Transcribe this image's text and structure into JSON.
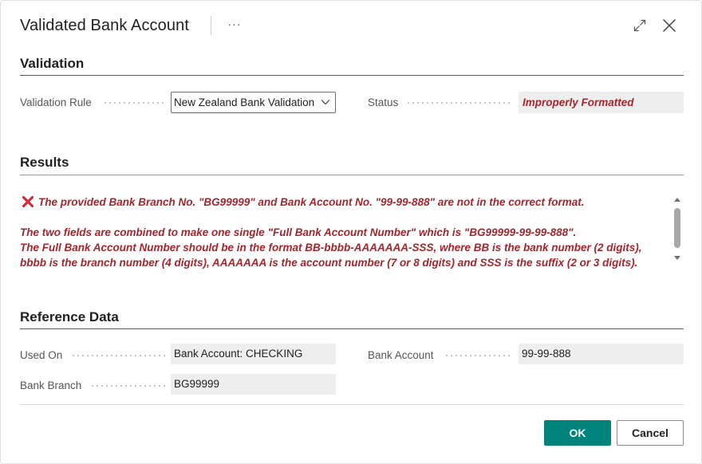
{
  "dialog": {
    "title": "Validated Bank Account",
    "more_label": "···"
  },
  "validation": {
    "section_title": "Validation",
    "rule_label": "Validation Rule",
    "rule_value": "New Zealand Bank Validation",
    "status_label": "Status",
    "status_value": "Improperly Formatted"
  },
  "results": {
    "section_title": "Results",
    "error_message": "The provided Bank Branch No. \"BG99999\" and Bank Account No. \"99-99-888\" are not in the correct format.",
    "details": [
      "The two fields are combined to make one single \"Full Bank Account Number\" which is \"BG99999-99-99-888\".",
      "The Full Bank Account Number should be in the format BB-bbbb-AAAAAAA-SSS, where BB is the bank number (2 digits),",
      "bbbb is the branch number (4 digits), AAAAAAA is the account number (7 or 8 digits) and SSS is the suffix (2 or 3 digits)."
    ]
  },
  "reference": {
    "section_title": "Reference Data",
    "used_on_label": "Used On",
    "used_on_value": "Bank Account: CHECKING",
    "bank_account_label": "Bank Account",
    "bank_account_value": "99-99-888",
    "bank_branch_label": "Bank Branch",
    "bank_branch_value": "BG99999"
  },
  "footer": {
    "ok_label": "OK",
    "cancel_label": "Cancel"
  },
  "colors": {
    "accent": "#00837a",
    "error": "#a4262c",
    "field_bg": "#eeeeee"
  },
  "icons": [
    "more-icon",
    "expand-icon",
    "close-icon",
    "chevron-down-icon",
    "error-x-icon",
    "scroll-up-icon",
    "scroll-down-icon"
  ]
}
